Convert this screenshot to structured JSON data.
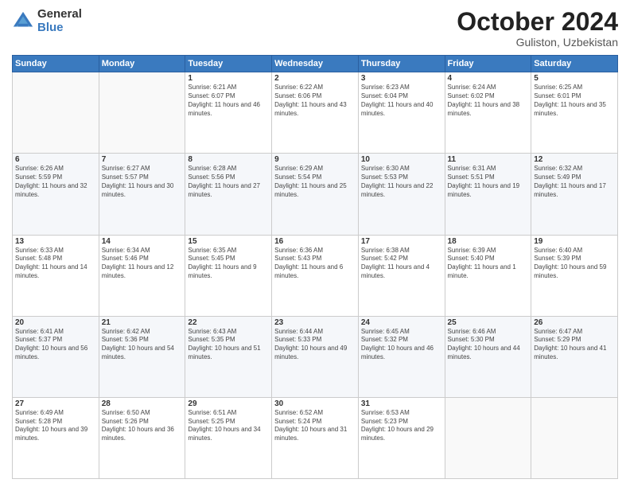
{
  "header": {
    "logo_general": "General",
    "logo_blue": "Blue",
    "title": "October 2024",
    "location": "Guliston, Uzbekistan"
  },
  "days_of_week": [
    "Sunday",
    "Monday",
    "Tuesday",
    "Wednesday",
    "Thursday",
    "Friday",
    "Saturday"
  ],
  "weeks": [
    [
      {
        "day": "",
        "sunrise": "",
        "sunset": "",
        "daylight": ""
      },
      {
        "day": "",
        "sunrise": "",
        "sunset": "",
        "daylight": ""
      },
      {
        "day": "1",
        "sunrise": "Sunrise: 6:21 AM",
        "sunset": "Sunset: 6:07 PM",
        "daylight": "Daylight: 11 hours and 46 minutes."
      },
      {
        "day": "2",
        "sunrise": "Sunrise: 6:22 AM",
        "sunset": "Sunset: 6:06 PM",
        "daylight": "Daylight: 11 hours and 43 minutes."
      },
      {
        "day": "3",
        "sunrise": "Sunrise: 6:23 AM",
        "sunset": "Sunset: 6:04 PM",
        "daylight": "Daylight: 11 hours and 40 minutes."
      },
      {
        "day": "4",
        "sunrise": "Sunrise: 6:24 AM",
        "sunset": "Sunset: 6:02 PM",
        "daylight": "Daylight: 11 hours and 38 minutes."
      },
      {
        "day": "5",
        "sunrise": "Sunrise: 6:25 AM",
        "sunset": "Sunset: 6:01 PM",
        "daylight": "Daylight: 11 hours and 35 minutes."
      }
    ],
    [
      {
        "day": "6",
        "sunrise": "Sunrise: 6:26 AM",
        "sunset": "Sunset: 5:59 PM",
        "daylight": "Daylight: 11 hours and 32 minutes."
      },
      {
        "day": "7",
        "sunrise": "Sunrise: 6:27 AM",
        "sunset": "Sunset: 5:57 PM",
        "daylight": "Daylight: 11 hours and 30 minutes."
      },
      {
        "day": "8",
        "sunrise": "Sunrise: 6:28 AM",
        "sunset": "Sunset: 5:56 PM",
        "daylight": "Daylight: 11 hours and 27 minutes."
      },
      {
        "day": "9",
        "sunrise": "Sunrise: 6:29 AM",
        "sunset": "Sunset: 5:54 PM",
        "daylight": "Daylight: 11 hours and 25 minutes."
      },
      {
        "day": "10",
        "sunrise": "Sunrise: 6:30 AM",
        "sunset": "Sunset: 5:53 PM",
        "daylight": "Daylight: 11 hours and 22 minutes."
      },
      {
        "day": "11",
        "sunrise": "Sunrise: 6:31 AM",
        "sunset": "Sunset: 5:51 PM",
        "daylight": "Daylight: 11 hours and 19 minutes."
      },
      {
        "day": "12",
        "sunrise": "Sunrise: 6:32 AM",
        "sunset": "Sunset: 5:49 PM",
        "daylight": "Daylight: 11 hours and 17 minutes."
      }
    ],
    [
      {
        "day": "13",
        "sunrise": "Sunrise: 6:33 AM",
        "sunset": "Sunset: 5:48 PM",
        "daylight": "Daylight: 11 hours and 14 minutes."
      },
      {
        "day": "14",
        "sunrise": "Sunrise: 6:34 AM",
        "sunset": "Sunset: 5:46 PM",
        "daylight": "Daylight: 11 hours and 12 minutes."
      },
      {
        "day": "15",
        "sunrise": "Sunrise: 6:35 AM",
        "sunset": "Sunset: 5:45 PM",
        "daylight": "Daylight: 11 hours and 9 minutes."
      },
      {
        "day": "16",
        "sunrise": "Sunrise: 6:36 AM",
        "sunset": "Sunset: 5:43 PM",
        "daylight": "Daylight: 11 hours and 6 minutes."
      },
      {
        "day": "17",
        "sunrise": "Sunrise: 6:38 AM",
        "sunset": "Sunset: 5:42 PM",
        "daylight": "Daylight: 11 hours and 4 minutes."
      },
      {
        "day": "18",
        "sunrise": "Sunrise: 6:39 AM",
        "sunset": "Sunset: 5:40 PM",
        "daylight": "Daylight: 11 hours and 1 minute."
      },
      {
        "day": "19",
        "sunrise": "Sunrise: 6:40 AM",
        "sunset": "Sunset: 5:39 PM",
        "daylight": "Daylight: 10 hours and 59 minutes."
      }
    ],
    [
      {
        "day": "20",
        "sunrise": "Sunrise: 6:41 AM",
        "sunset": "Sunset: 5:37 PM",
        "daylight": "Daylight: 10 hours and 56 minutes."
      },
      {
        "day": "21",
        "sunrise": "Sunrise: 6:42 AM",
        "sunset": "Sunset: 5:36 PM",
        "daylight": "Daylight: 10 hours and 54 minutes."
      },
      {
        "day": "22",
        "sunrise": "Sunrise: 6:43 AM",
        "sunset": "Sunset: 5:35 PM",
        "daylight": "Daylight: 10 hours and 51 minutes."
      },
      {
        "day": "23",
        "sunrise": "Sunrise: 6:44 AM",
        "sunset": "Sunset: 5:33 PM",
        "daylight": "Daylight: 10 hours and 49 minutes."
      },
      {
        "day": "24",
        "sunrise": "Sunrise: 6:45 AM",
        "sunset": "Sunset: 5:32 PM",
        "daylight": "Daylight: 10 hours and 46 minutes."
      },
      {
        "day": "25",
        "sunrise": "Sunrise: 6:46 AM",
        "sunset": "Sunset: 5:30 PM",
        "daylight": "Daylight: 10 hours and 44 minutes."
      },
      {
        "day": "26",
        "sunrise": "Sunrise: 6:47 AM",
        "sunset": "Sunset: 5:29 PM",
        "daylight": "Daylight: 10 hours and 41 minutes."
      }
    ],
    [
      {
        "day": "27",
        "sunrise": "Sunrise: 6:49 AM",
        "sunset": "Sunset: 5:28 PM",
        "daylight": "Daylight: 10 hours and 39 minutes."
      },
      {
        "day": "28",
        "sunrise": "Sunrise: 6:50 AM",
        "sunset": "Sunset: 5:26 PM",
        "daylight": "Daylight: 10 hours and 36 minutes."
      },
      {
        "day": "29",
        "sunrise": "Sunrise: 6:51 AM",
        "sunset": "Sunset: 5:25 PM",
        "daylight": "Daylight: 10 hours and 34 minutes."
      },
      {
        "day": "30",
        "sunrise": "Sunrise: 6:52 AM",
        "sunset": "Sunset: 5:24 PM",
        "daylight": "Daylight: 10 hours and 31 minutes."
      },
      {
        "day": "31",
        "sunrise": "Sunrise: 6:53 AM",
        "sunset": "Sunset: 5:23 PM",
        "daylight": "Daylight: 10 hours and 29 minutes."
      },
      {
        "day": "",
        "sunrise": "",
        "sunset": "",
        "daylight": ""
      },
      {
        "day": "",
        "sunrise": "",
        "sunset": "",
        "daylight": ""
      }
    ]
  ]
}
